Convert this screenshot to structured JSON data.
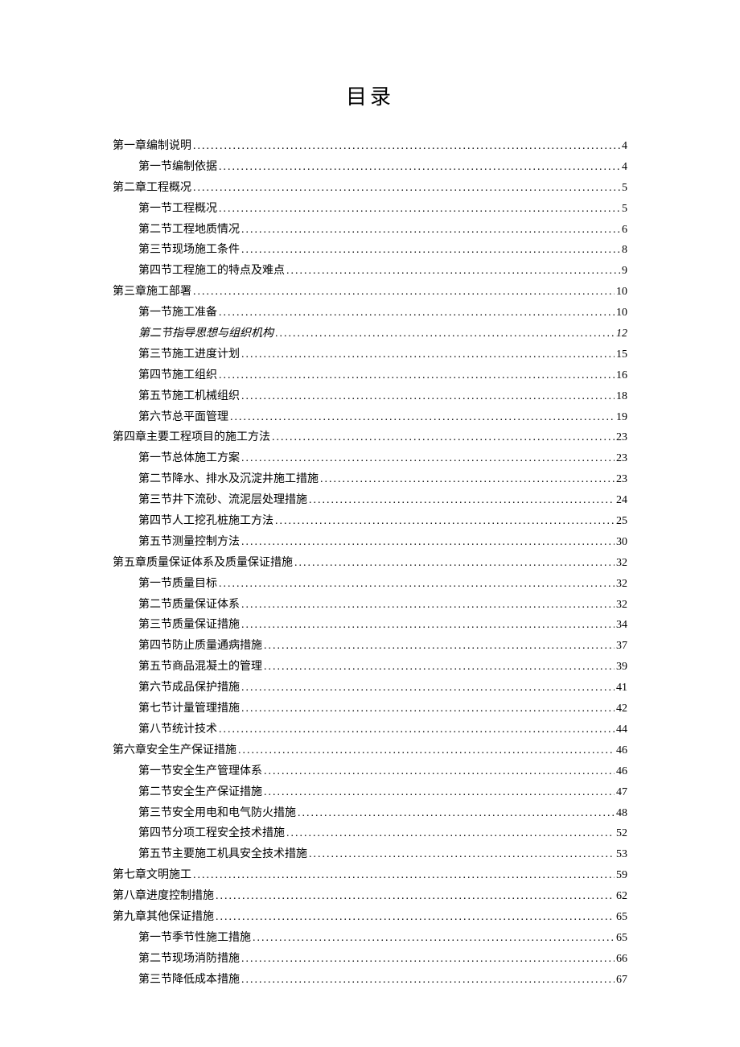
{
  "title": "目录",
  "entries": [
    {
      "level": 1,
      "label": "第一章编制说明",
      "page": "4",
      "italic": false
    },
    {
      "level": 2,
      "label": "第一节编制依据",
      "page": "4",
      "italic": false
    },
    {
      "level": 1,
      "label": "第二章工程概况",
      "page": "5",
      "italic": false
    },
    {
      "level": 2,
      "label": "第一节工程概况",
      "page": "5",
      "italic": false
    },
    {
      "level": 2,
      "label": "第二节工程地质情况",
      "page": "6",
      "italic": false
    },
    {
      "level": 2,
      "label": "第三节现场施工条件",
      "page": "8",
      "italic": false
    },
    {
      "level": 2,
      "label": "第四节工程施工的特点及难点",
      "page": "9",
      "italic": false
    },
    {
      "level": 1,
      "label": "第三章施工部署",
      "page": "10",
      "italic": false
    },
    {
      "level": 2,
      "label": "第一节施工准备",
      "page": "10",
      "italic": false
    },
    {
      "level": 2,
      "label": "第二节指导思想与组织机构",
      "page": "12",
      "italic": true
    },
    {
      "level": 2,
      "label": "第三节施工进度计划",
      "page": "15",
      "italic": false
    },
    {
      "level": 2,
      "label": "第四节施工组织",
      "page": "16",
      "italic": false
    },
    {
      "level": 2,
      "label": "第五节施工机械组织",
      "page": "18",
      "italic": false
    },
    {
      "level": 2,
      "label": "第六节总平面管理",
      "page": "19",
      "italic": false
    },
    {
      "level": 1,
      "label": "第四章主要工程项目的施工方法",
      "page": "23",
      "italic": false
    },
    {
      "level": 2,
      "label": "第一节总体施工方案",
      "page": "23",
      "italic": false
    },
    {
      "level": 2,
      "label": "第二节降水、排水及沉淀井施工措施",
      "page": "23",
      "italic": false
    },
    {
      "level": 2,
      "label": "第三节井下流砂、流泥层处理措施",
      "page": "24",
      "italic": false
    },
    {
      "level": 2,
      "label": "第四节人工挖孔桩施工方法",
      "page": "25",
      "italic": false
    },
    {
      "level": 2,
      "label": "第五节测量控制方法",
      "page": "30",
      "italic": false
    },
    {
      "level": 1,
      "label": "第五章质量保证体系及质量保证措施",
      "page": "32",
      "italic": false
    },
    {
      "level": 2,
      "label": "第一节质量目标",
      "page": "32",
      "italic": false
    },
    {
      "level": 2,
      "label": "第二节质量保证体系",
      "page": "32",
      "italic": false
    },
    {
      "level": 2,
      "label": "第三节质量保证措施",
      "page": "34",
      "italic": false
    },
    {
      "level": 2,
      "label": "第四节防止质量通病措施",
      "page": "37",
      "italic": false
    },
    {
      "level": 2,
      "label": "第五节商品混凝土的管理",
      "page": "39",
      "italic": false
    },
    {
      "level": 2,
      "label": "第六节成品保护措施",
      "page": "41",
      "italic": false
    },
    {
      "level": 2,
      "label": "第七节计量管理措施",
      "page": "42",
      "italic": false
    },
    {
      "level": 2,
      "label": "第八节统计技术",
      "page": "44",
      "italic": false
    },
    {
      "level": 1,
      "label": "第六章安全生产保证措施",
      "page": "46",
      "italic": false
    },
    {
      "level": 2,
      "label": "第一节安全生产管理体系",
      "page": "46",
      "italic": false
    },
    {
      "level": 2,
      "label": "第二节安全生产保证措施",
      "page": "47",
      "italic": false
    },
    {
      "level": 2,
      "label": "第三节安全用电和电气防火措施",
      "page": "48",
      "italic": false
    },
    {
      "level": 2,
      "label": "第四节分项工程安全技术措施",
      "page": "52",
      "italic": false
    },
    {
      "level": 2,
      "label": "第五节主要施工机具安全技术措施",
      "page": "53",
      "italic": false
    },
    {
      "level": 1,
      "label": "第七章文明施工",
      "page": "59",
      "italic": false
    },
    {
      "level": 1,
      "label": "第八章进度控制措施",
      "page": "62",
      "italic": false
    },
    {
      "level": 1,
      "label": "第九章其他保证措施",
      "page": "65",
      "italic": false
    },
    {
      "level": 2,
      "label": "第一节季节性施工措施",
      "page": "65",
      "italic": false
    },
    {
      "level": 2,
      "label": "第二节现场消防措施",
      "page": "66",
      "italic": false
    },
    {
      "level": 2,
      "label": "第三节降低成本措施",
      "page": "67",
      "italic": false
    }
  ]
}
